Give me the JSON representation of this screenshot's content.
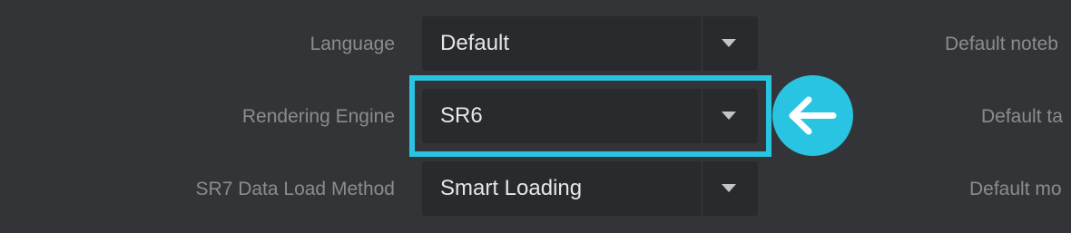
{
  "settings": {
    "rows": [
      {
        "label": "Language",
        "value": "Default"
      },
      {
        "label": "Rendering Engine",
        "value": "SR6"
      },
      {
        "label": "SR7 Data Load Method",
        "value": "Smart Loading"
      }
    ],
    "right_column": [
      {
        "label": "Default noteb"
      },
      {
        "label": "Default ta"
      },
      {
        "label": "Default mo"
      }
    ]
  },
  "annotation": {
    "highlight_color": "#29c4e2",
    "pointer_icon": "arrow-left-icon"
  }
}
